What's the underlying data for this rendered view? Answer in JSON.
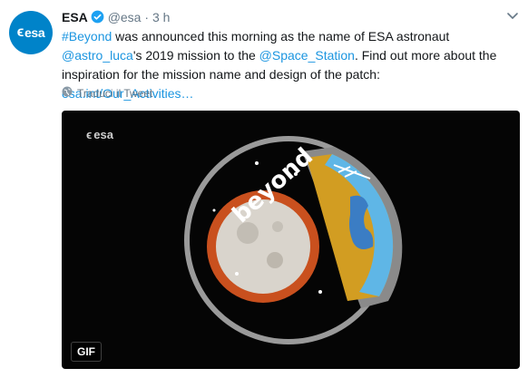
{
  "tweet": {
    "author_name": "ESA",
    "handle": "@esa",
    "separator": "·",
    "time": "3 h",
    "avatar_text": "esa",
    "text_segments": [
      {
        "text": "#Beyond",
        "link": true
      },
      {
        "text": " was announced this morning as the name of ESA astronaut ",
        "link": false
      },
      {
        "text": "@astro_luca",
        "link": true
      },
      {
        "text": "'s 2019 mission to the ",
        "link": false
      },
      {
        "text": "@Space_Station",
        "link": true
      },
      {
        "text": ". Find out more about the inspiration for the mission name and design of the patch: ",
        "link": false
      },
      {
        "text": "esa.int/Our_Activities…",
        "link": true
      }
    ],
    "translate_label": "Traduci il Tweet"
  },
  "media": {
    "logo_text": "esa",
    "patch_word": "beyond",
    "badge": "GIF"
  },
  "colors": {
    "link": "#1b95e0",
    "avatar_bg": "#0083c9",
    "verified": "#1da1f2",
    "muted": "#657786"
  },
  "icons": [
    "chevron-down-icon",
    "verified-icon",
    "globe-icon",
    "esa-logo-icon"
  ]
}
